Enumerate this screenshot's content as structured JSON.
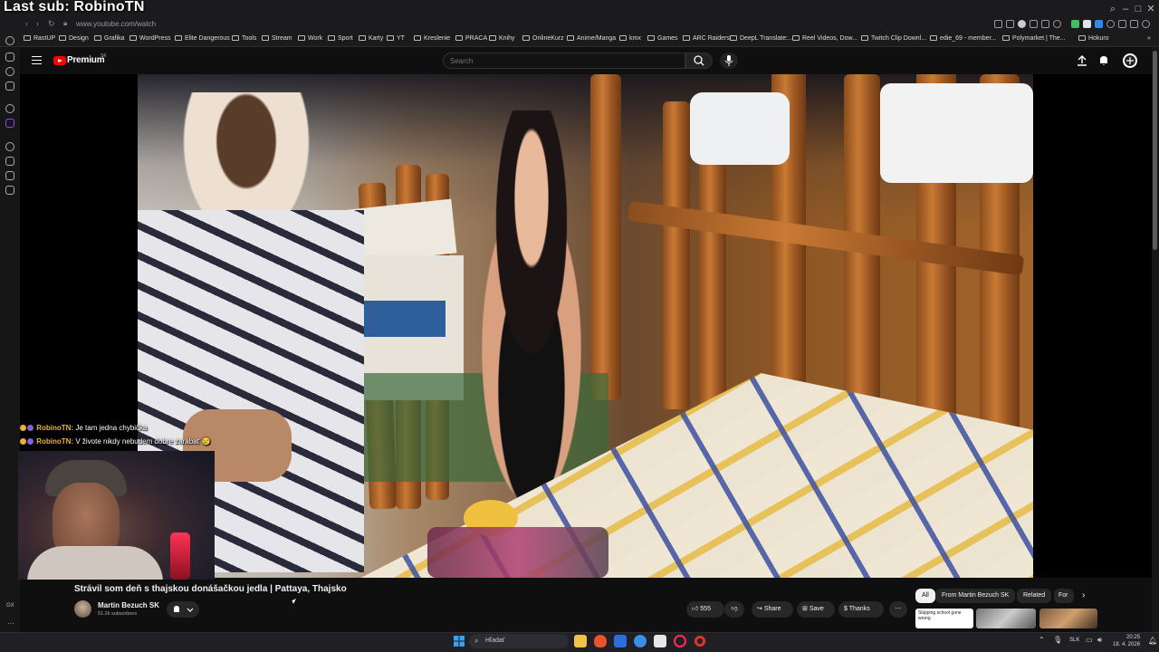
{
  "overlay": {
    "title": "Last sub: RobinoTN"
  },
  "browser": {
    "url": "www.youtube.com/watch",
    "bookmarks": [
      "RastUP",
      "Design",
      "Grafika",
      "WordPress",
      "Elite Dangerous",
      "Tools",
      "Stream",
      "Work",
      "Sport",
      "Karty",
      "YT",
      "Kreslenie",
      "PRACA",
      "Knihy",
      "OnlineKurz",
      "Anime/Manga",
      "kmx",
      "Games",
      "ARC Raiders",
      "DeepL Translate:...",
      "Reel Videos, Dow...",
      "Twitch Clip Downl...",
      "edie_69 - member...",
      "Polymarket | The...",
      "Hokuro"
    ]
  },
  "youtube": {
    "brand": "Premium",
    "region": "SK",
    "search_placeholder": "Search",
    "video": {
      "title": "Strávil som deň s thajskou donášačkou jedla | Pattaya, Thajsko",
      "channel": "Martin Bezuch SK",
      "subscribers": "51.2k subscribers",
      "likes": "555",
      "share": "Share",
      "save": "Save",
      "thanks": "Thanks"
    },
    "chips": [
      "All",
      "From Martin Bezuch SK",
      "Related",
      "For"
    ],
    "thumb_text": "Skipping school gone wrong"
  },
  "chat": [
    {
      "user": "RobinoTN:",
      "message": "Je tam jedna chybička"
    },
    {
      "user": "RobinoTN:",
      "message": "V živote nikdy nebudem dobre zarábať 😢"
    }
  ],
  "sidebar_bottom": "GX",
  "taskbar": {
    "search": "Hľadať",
    "lang": "SLK",
    "time": "20:25",
    "date": "18. 4. 2026"
  },
  "colors": {
    "accent_red": "#ff0000",
    "background": "#0f0f0f",
    "chat_user": "#e8b33a"
  }
}
